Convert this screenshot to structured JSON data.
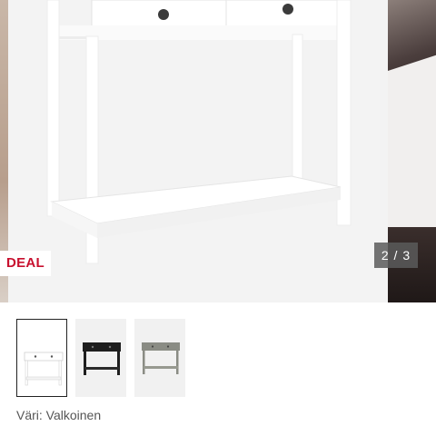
{
  "product_gallery": {
    "deal_badge": "DEAL",
    "counter": "2 / 3",
    "current_slide": 2,
    "total_slides": 3,
    "thumbnails": [
      {
        "color": "white",
        "selected": true
      },
      {
        "color": "black",
        "selected": false
      },
      {
        "color": "grey",
        "selected": false
      }
    ]
  },
  "color_selection": {
    "label": "Väri: Valkoinen"
  },
  "colors": {
    "deal_red": "#c8102e",
    "counter_bg": "#5a5a5a",
    "thumb_border": "#222222"
  }
}
